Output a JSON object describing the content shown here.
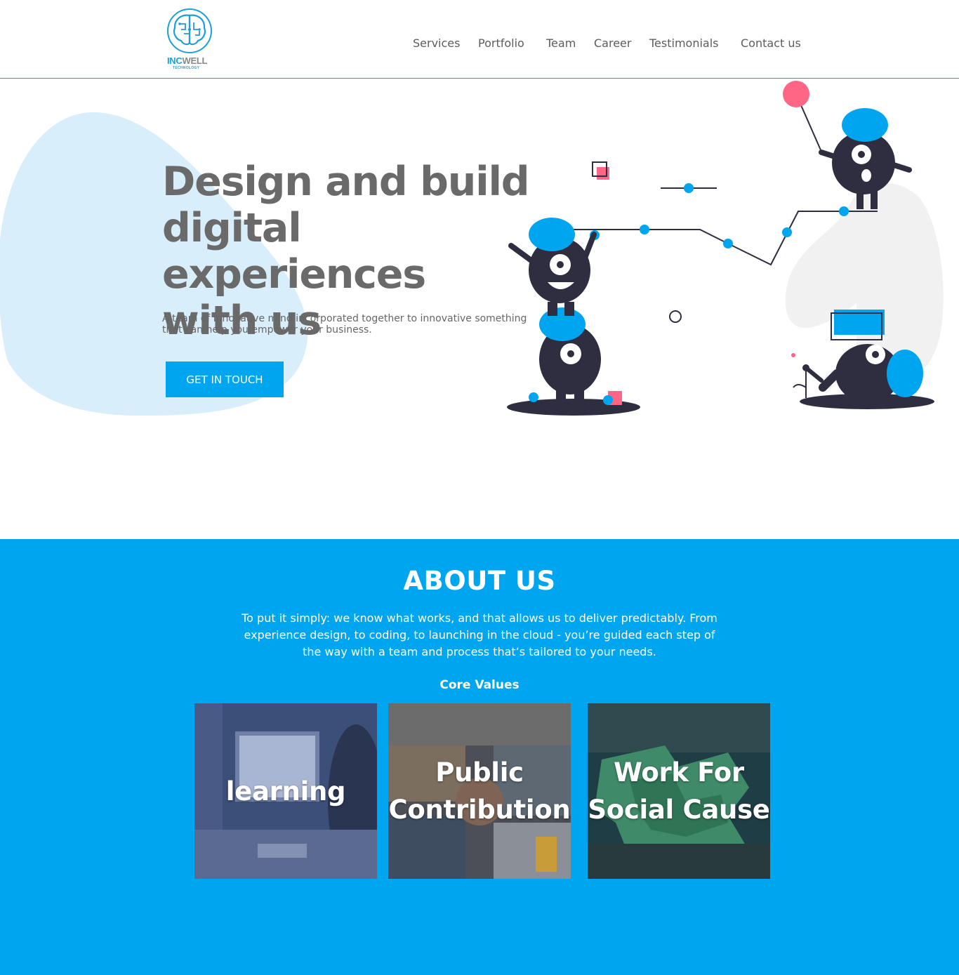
{
  "header": {
    "logo": {
      "name_part1": "INC",
      "name_part2": "WELL",
      "tagline": "TECHNOLOGY",
      "icon": "brain-circuit-icon"
    },
    "nav": [
      "Services",
      "Portfolio",
      "Team",
      "Career",
      "Testimonials",
      "Contact us"
    ]
  },
  "hero": {
    "title_lines": [
      "Design and build",
      "digital experiences",
      "with us"
    ],
    "subtitle_lines": [
      "A team of innovative mind incorporated together to innovative something",
      "that can help you empower your business."
    ],
    "cta_label": "GET IN TOUCH"
  },
  "about": {
    "title": "ABOUT US",
    "text_lines": [
      "To put it simply: we know what works, and that allows us to deliver predictably. From",
      "experience design, to coding, to launching in the cloud - you’re guided each step of",
      "the way with a team and process that’s tailored to your needs."
    ],
    "core_values_title": "Core Values",
    "cards": [
      {
        "label_lines": [
          "learning"
        ]
      },
      {
        "label_lines": [
          "Public",
          "Contribution"
        ]
      },
      {
        "label_lines": [
          "Work For",
          "Social Cause"
        ]
      }
    ]
  },
  "colors": {
    "accent": "#00a5ef",
    "blob": "#d8eefb",
    "dark": "#2f2e41",
    "pink": "#ff6584",
    "text_gray": "#6a6a6a"
  }
}
